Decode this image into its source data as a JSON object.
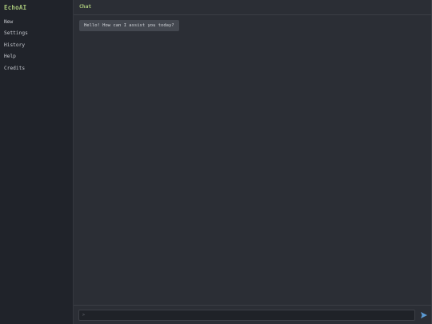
{
  "sidebar": {
    "brand": "EchoAI",
    "items": [
      {
        "label": "New"
      },
      {
        "label": "Settings"
      },
      {
        "label": "History"
      },
      {
        "label": "Help"
      },
      {
        "label": "Credits"
      }
    ]
  },
  "header": {
    "title": "Chat"
  },
  "chat": {
    "messages": [
      {
        "text": "Hello! How can I assist you today?"
      }
    ]
  },
  "composer": {
    "value": "",
    "placeholder": ">"
  },
  "icons": {
    "send": "send-arrow-icon"
  },
  "colors": {
    "accent": "#a8c77a",
    "send": "#5b9bd5",
    "sidebar_bg": "#20232a",
    "main_bg": "#2b2e35"
  }
}
